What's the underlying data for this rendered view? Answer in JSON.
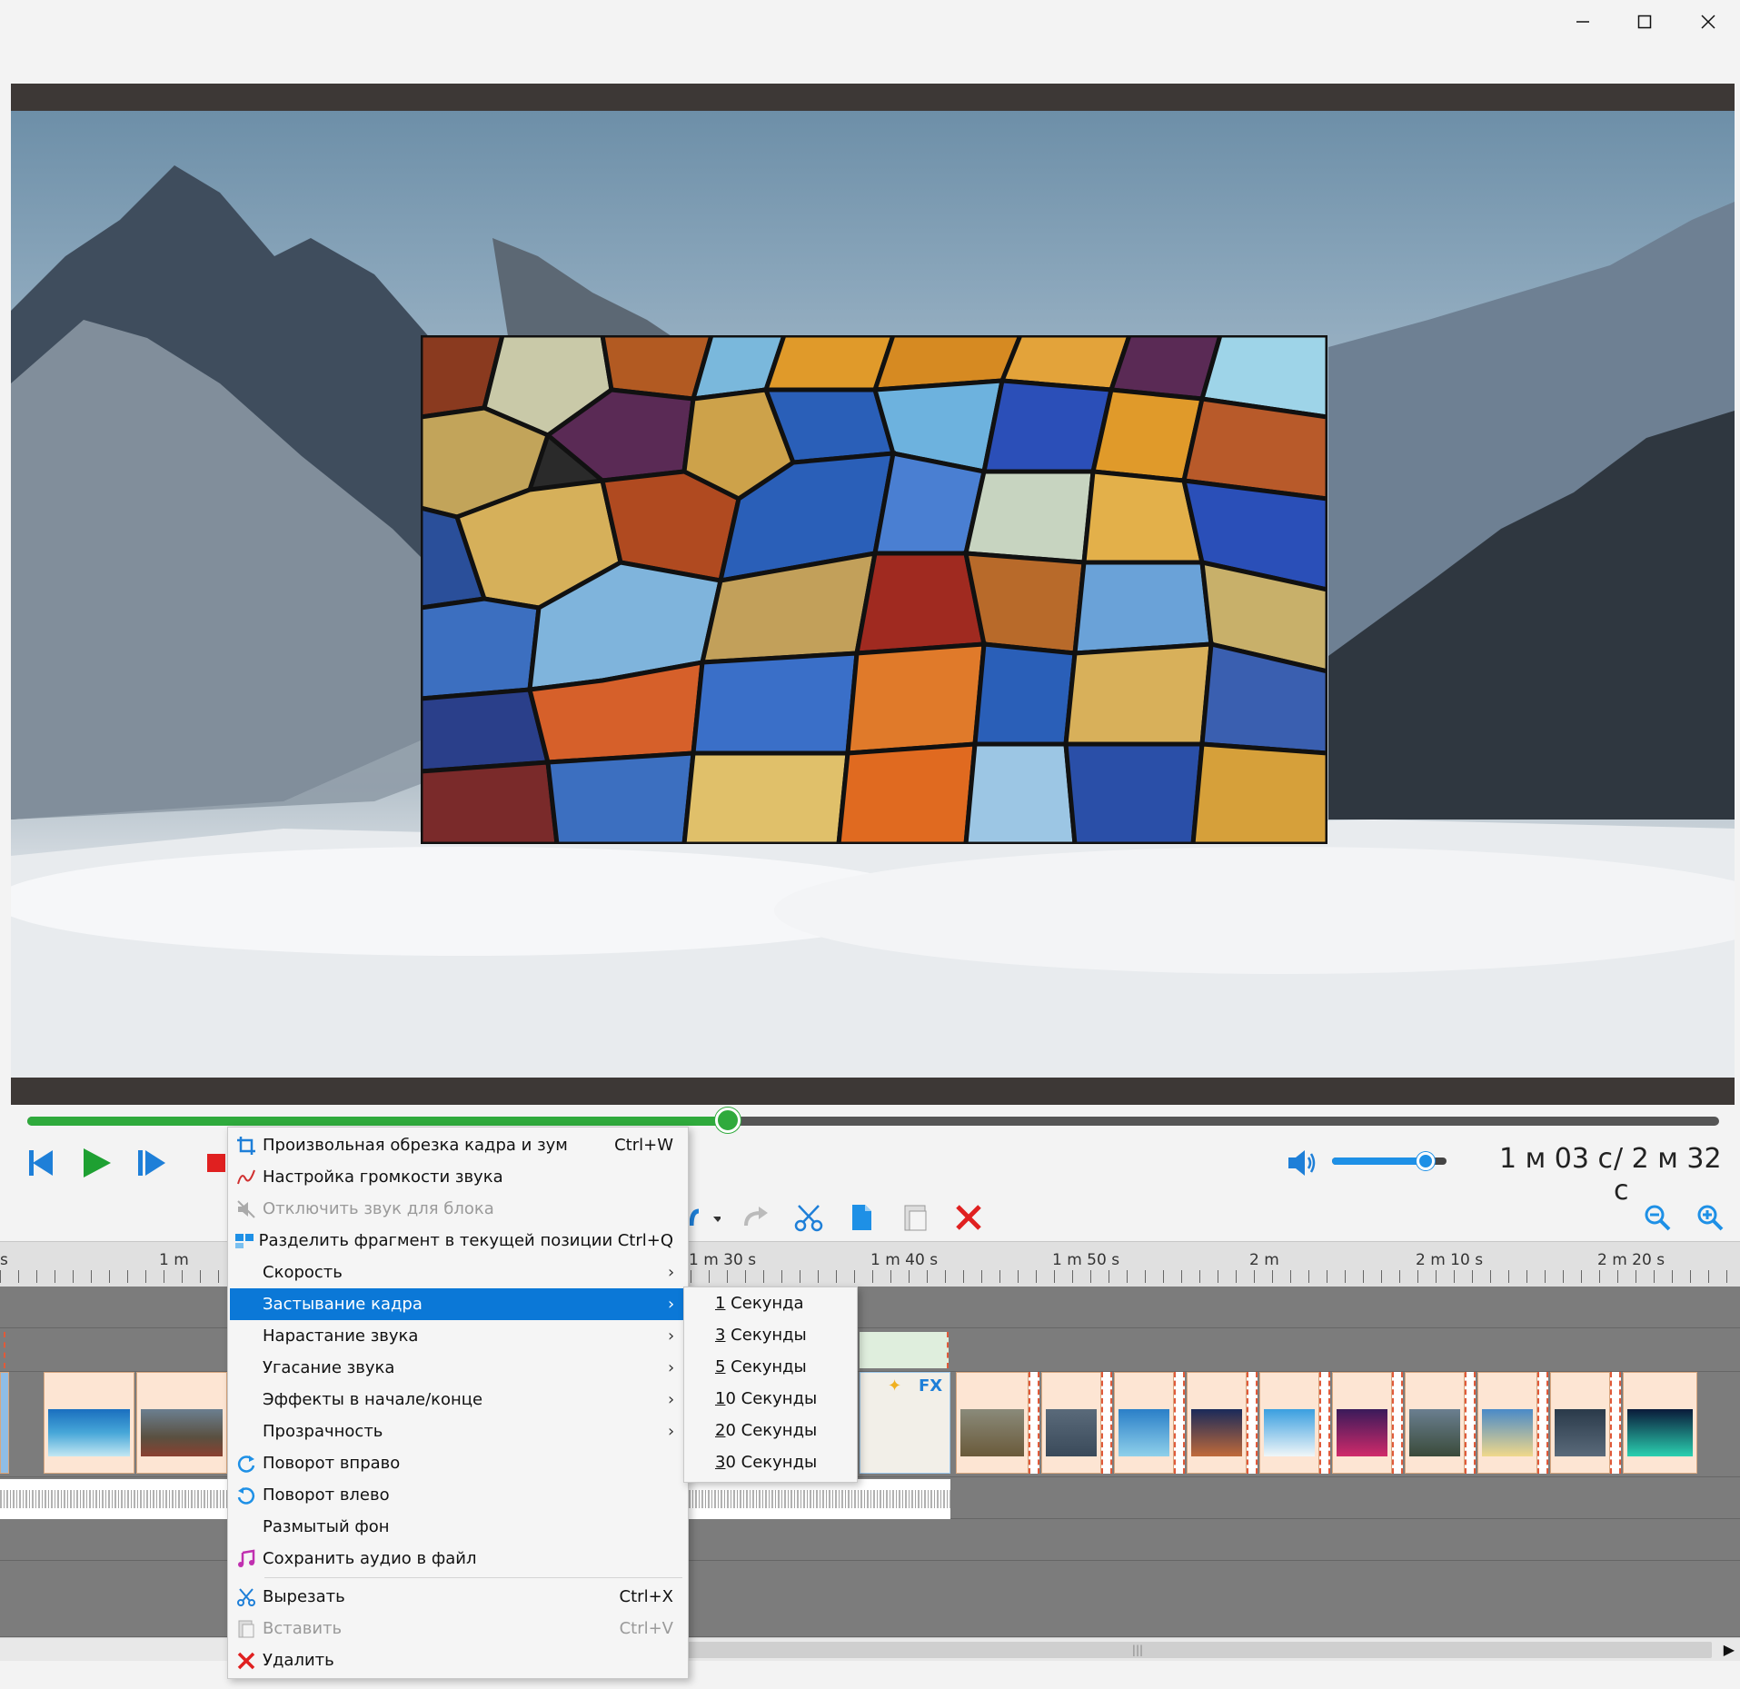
{
  "window": {
    "controls": [
      "minimize-icon",
      "maximize-icon",
      "close-icon"
    ]
  },
  "player": {
    "progress_fraction": 0.414,
    "volume_fraction": 0.82,
    "time_current": "1 м 03 с",
    "time_total": "/ 2 м 32 с"
  },
  "timeline": {
    "ruler_labels": [
      {
        "text": "s"
      },
      {
        "text": "1 m"
      },
      {
        "text": "1 m 30 s"
      },
      {
        "text": "1 m 40 s"
      },
      {
        "text": "1 m 50 s"
      },
      {
        "text": "2 m"
      },
      {
        "text": "2 m 10 s"
      },
      {
        "text": "2 m 20 s"
      }
    ],
    "fx_label": "FX"
  },
  "context_menu": {
    "items": [
      {
        "label": "Произвольная обрезка кадра и зум",
        "shortcut": "Ctrl+W",
        "icon": "crop-icon"
      },
      {
        "label": "Настройка громкости звука",
        "shortcut": "",
        "icon": "volume-curve-icon"
      },
      {
        "label": "Отключить звук для блока",
        "shortcut": "",
        "icon": "mute-icon",
        "disabled": true
      },
      {
        "label": "Разделить фрагмент в текущей позиции",
        "shortcut": "Ctrl+Q",
        "icon": "split-icon"
      },
      {
        "label": "Скорость",
        "shortcut": "",
        "submenu": true
      },
      {
        "label": "Застывание кадра",
        "shortcut": "",
        "submenu": true,
        "selected": true
      },
      {
        "label": "Нарастание звука",
        "shortcut": "",
        "submenu": true
      },
      {
        "label": "Угасание звука",
        "shortcut": "",
        "submenu": true
      },
      {
        "label": "Эффекты в начале/конце",
        "shortcut": "",
        "submenu": true
      },
      {
        "label": "Прозрачность",
        "shortcut": "",
        "submenu": true
      },
      {
        "label": "Поворот вправо",
        "shortcut": "",
        "icon": "rotate-right-icon"
      },
      {
        "label": "Поворот влево",
        "shortcut": "",
        "icon": "rotate-left-icon"
      },
      {
        "label": "Размытый фон",
        "shortcut": ""
      },
      {
        "label": "Сохранить аудио в файл",
        "shortcut": "",
        "icon": "music-note-icon"
      },
      {
        "label": "Вырезать",
        "shortcut": "Ctrl+X",
        "icon": "scissors-icon"
      },
      {
        "label": "Вставить",
        "shortcut": "Ctrl+V",
        "icon": "paste-icon",
        "disabled": true
      },
      {
        "label": "Удалить",
        "shortcut": "",
        "icon": "delete-icon"
      }
    ]
  },
  "freeze_submenu": {
    "items": [
      {
        "key": "1",
        "rest": " Секунда"
      },
      {
        "key": "3",
        "rest": " Секунды"
      },
      {
        "key": "5",
        "rest": " Секунды"
      },
      {
        "key": "1",
        "rest": "0 Секунды"
      },
      {
        "key": "2",
        "rest": "0 Секунды"
      },
      {
        "key": "3",
        "rest": "0 Секунды"
      }
    ]
  },
  "colors": {
    "accent": "#0b78d7",
    "seek": "#2faa3c",
    "volume": "#1e90e6",
    "delete": "#e02020"
  }
}
